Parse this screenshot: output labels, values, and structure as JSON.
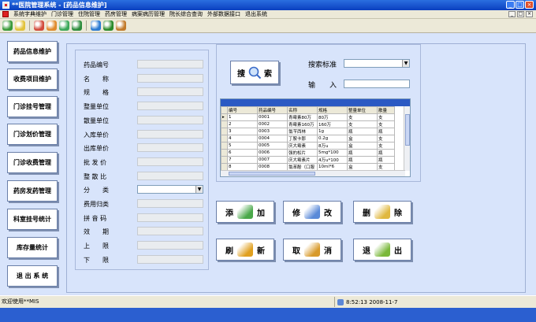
{
  "window": {
    "title": "**医院管理系统 - [药品信息维护]",
    "buttons": [
      "_",
      "□",
      "×"
    ]
  },
  "menu": [
    "系统字典维护",
    "门诊管理",
    "住院管理",
    "药房管理",
    "病案病历管理",
    "院长综合查询",
    "外部数据接口",
    "退出系统"
  ],
  "mdi_controls": [
    "_",
    "□",
    "×"
  ],
  "toolbar_icons": [
    {
      "name": "drugs-icon",
      "color": "#3a9a3a"
    },
    {
      "name": "puzzle-icon",
      "color": "#e2c23a"
    },
    {
      "name": "flags-icon",
      "color": "#d24a3a"
    },
    {
      "name": "fan-icon",
      "color": "#e08a2a"
    },
    {
      "name": "people-icon",
      "color": "#3aa85a"
    },
    {
      "name": "gear-icon",
      "color": "#2c8c3c"
    },
    {
      "name": "globe-icon",
      "color": "#2a7ad2"
    },
    {
      "name": "ball-icon",
      "color": "#2a8a2a"
    },
    {
      "name": "book-icon",
      "color": "#c27a2a"
    }
  ],
  "nav": [
    "药品信息维护",
    "收费项目维护",
    "门诊挂号管理",
    "门诊划价管理",
    "门诊收费管理",
    "药房发药管理",
    "科室挂号统计",
    "库存量统计",
    "退 出 系 统"
  ],
  "form": {
    "fields": [
      {
        "label": "药品编号",
        "type": "text",
        "value": ""
      },
      {
        "label": "名　　称",
        "type": "text",
        "value": ""
      },
      {
        "label": "规　　格",
        "type": "text",
        "value": ""
      },
      {
        "label": "整量单位",
        "type": "text",
        "value": ""
      },
      {
        "label": "散量单位",
        "type": "text",
        "value": ""
      },
      {
        "label": "入库单价",
        "type": "text",
        "value": ""
      },
      {
        "label": "出库单价",
        "type": "text",
        "value": ""
      },
      {
        "label": "批 发 价",
        "type": "text",
        "value": ""
      },
      {
        "label": "整 散 比",
        "type": "text",
        "value": ""
      },
      {
        "label": "分　　类",
        "type": "select",
        "value": ""
      },
      {
        "label": "费用归类",
        "type": "text",
        "value": ""
      },
      {
        "label": "拼 音 码",
        "type": "text",
        "value": ""
      },
      {
        "label": "效　　期",
        "type": "text",
        "value": ""
      },
      {
        "label": "上　　限",
        "type": "text",
        "value": ""
      },
      {
        "label": "下　　限",
        "type": "text",
        "value": ""
      }
    ]
  },
  "search": {
    "button_label": "搜　索",
    "criteria_label": "搜索标准",
    "criteria_value": "",
    "input_label": "输　　入",
    "input_value": ""
  },
  "grid": {
    "columns": [
      "编号",
      "药品编号",
      "名称",
      "规格",
      "整量单位",
      "散量"
    ],
    "rows": [
      [
        "1",
        "0001",
        "青霉素80万",
        "80万",
        "支",
        "支"
      ],
      [
        "2",
        "0002",
        "青霉素160万",
        "160万",
        "支",
        "支"
      ],
      [
        "3",
        "0003",
        "氯苄西林",
        "1g",
        "瓶",
        "瓶"
      ],
      [
        "4",
        "0004",
        "丁胺卡那",
        "0.2g",
        "盒",
        "支"
      ],
      [
        "5",
        "0005",
        "庆大霉素",
        "8万u",
        "盒",
        "支"
      ],
      [
        "6",
        "0006",
        "强的松片",
        "5mg*100",
        "瓶",
        "瓶"
      ],
      [
        "7",
        "0007",
        "庆大霉素片",
        "4万u*100",
        "瓶",
        "瓶"
      ],
      [
        "8",
        "0008",
        "氯苯酚（口服",
        "10ml*6",
        "盒",
        "支"
      ]
    ]
  },
  "actions": [
    {
      "label1": "添",
      "label2": "加",
      "icon": "add-icon",
      "color": "#4aa84a"
    },
    {
      "label1": "修",
      "label2": "改",
      "icon": "edit-icon",
      "color": "#5a8ad8"
    },
    {
      "label1": "删",
      "label2": "除",
      "icon": "delete-icon",
      "color": "#e0b840"
    },
    {
      "label1": "刷",
      "label2": "新",
      "icon": "refresh-icon",
      "color": "#e0a020"
    },
    {
      "label1": "取",
      "label2": "消",
      "icon": "cancel-icon",
      "color": "#d89a2a"
    },
    {
      "label1": "退",
      "label2": "出",
      "icon": "exit-icon",
      "color": "#7ab83a"
    }
  ],
  "status": {
    "left": "欢迎使用**MIS",
    "right": "8:52:13  2008-11-7"
  }
}
